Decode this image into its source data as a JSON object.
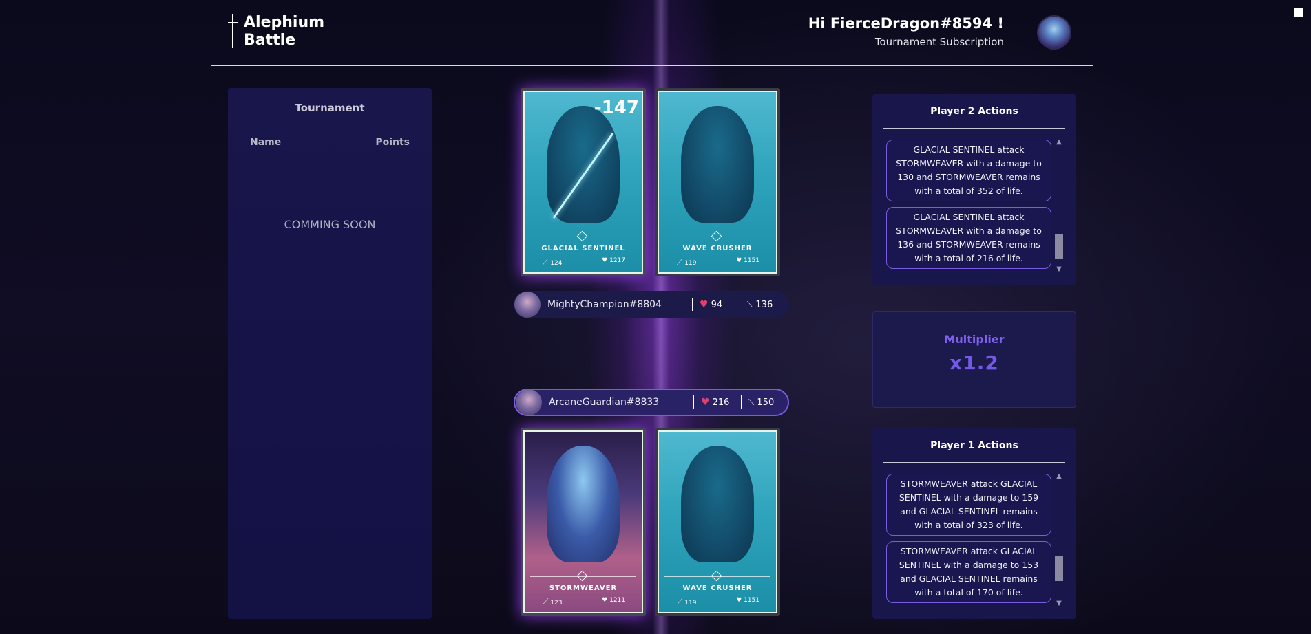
{
  "header": {
    "logo_line1": "Alephium",
    "logo_line2": "Battle",
    "greeting": "Hi FierceDragon#8594 !",
    "subtitle": "Tournament Subscription"
  },
  "tournament": {
    "title": "Tournament",
    "col_name": "Name",
    "col_points": "Points",
    "status": "COMMING SOON"
  },
  "opponent": {
    "name": "MightyChampion#8804",
    "life": "94",
    "attack": "136",
    "cards": [
      {
        "name": "GLACIAL SENTINEL",
        "attack": "124",
        "life": "1217",
        "damage_popup": "-147"
      },
      {
        "name": "WAVE CRUSHER",
        "attack": "119",
        "life": "1151"
      }
    ]
  },
  "player": {
    "name": "ArcaneGuardian#8833",
    "life": "216",
    "attack": "150",
    "cards": [
      {
        "name": "STORMWEAVER",
        "attack": "123",
        "life": "1211"
      },
      {
        "name": "WAVE CRUSHER",
        "attack": "119",
        "life": "1151"
      }
    ]
  },
  "player2_actions": {
    "title": "Player 2 Actions",
    "items": [
      "GLACIAL SENTINEL attack STORMWEAVER with a damage to 130 and STORMWEAVER remains with a total of 352 of life.",
      "GLACIAL SENTINEL attack STORMWEAVER with a damage to 136 and STORMWEAVER remains with a total of 216 of life."
    ]
  },
  "multiplier": {
    "label": "Multiplier",
    "value": "x1.2"
  },
  "player1_actions": {
    "title": "Player 1 Actions",
    "items": [
      "STORMWEAVER attack GLACIAL SENTINEL with a damage to 159 and GLACIAL SENTINEL remains with a total of 323 of life.",
      "STORMWEAVER attack GLACIAL SENTINEL with a damage to 153 and GLACIAL SENTINEL remains with a total of 170 of life."
    ]
  },
  "icons": {
    "sword": "sword-icon",
    "heart": "heart-icon",
    "logo": "sword-logo-icon"
  },
  "colors": {
    "accent": "#7458e8",
    "panel_bg": "#18164a",
    "heart": "#e0406a"
  }
}
